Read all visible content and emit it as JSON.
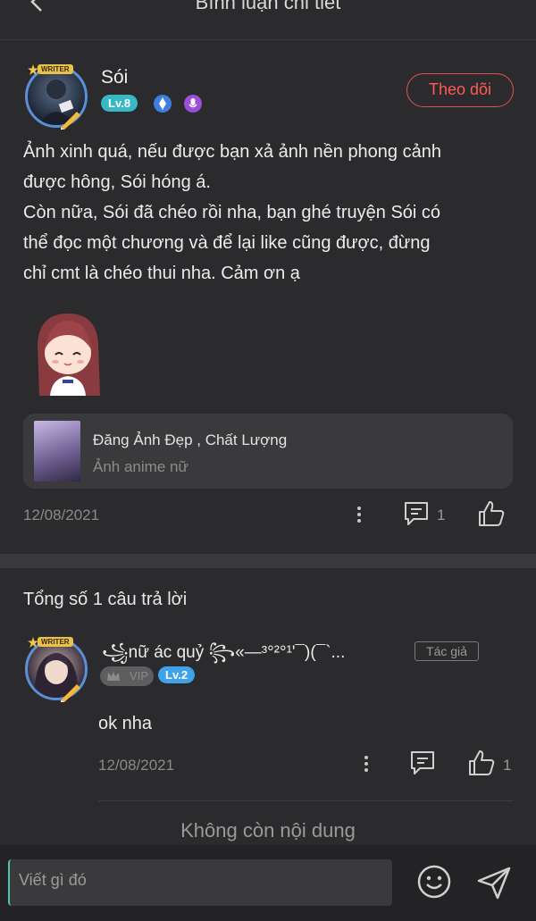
{
  "header": {
    "title": "Bình luận chi tiết"
  },
  "comment": {
    "frame_label": "WRITER",
    "username": "Sói",
    "level": "Lv.8",
    "follow_label": "Theo dõi",
    "body": [
      "Ảnh xinh quá, nếu được bạn xả ảnh nền phong cảnh",
      "được hông, Sói hóng á.",
      "Còn nữa, Sói đã chéo rồi nha, bạn ghé truyện Sói có",
      "thể đọc một chương và để lại like cũng được, đừng",
      "chỉ cmt là chéo thui nha. Cảm ơn ạ"
    ],
    "link_card": {
      "title": "Đăng Ảnh Đẹp , Chất Lượng",
      "subtitle": "Ảnh anime nữ"
    },
    "date": "12/08/2021",
    "reply_count": "1"
  },
  "replies": {
    "total_label": "Tổng số 1 câu trả lời",
    "items": [
      {
        "frame_label": "WRITER",
        "name": "꧁nữ ác quỷ ꧂«—³°²°¹'¯)(¯`...",
        "author_tag": "Tác giả",
        "vip_label": "VIP",
        "level": "Lv.2",
        "text": "ok nha",
        "date": "12/08/2021",
        "like_count": "1"
      }
    ],
    "no_more": "Không còn nội dung"
  },
  "composer": {
    "placeholder": "Viết gì đó"
  },
  "colors": {
    "accent_red": "#ff5a55",
    "level_teal": "#37b8c4",
    "level_blue": "#3fa2ea",
    "background": "#2b2b2d"
  }
}
